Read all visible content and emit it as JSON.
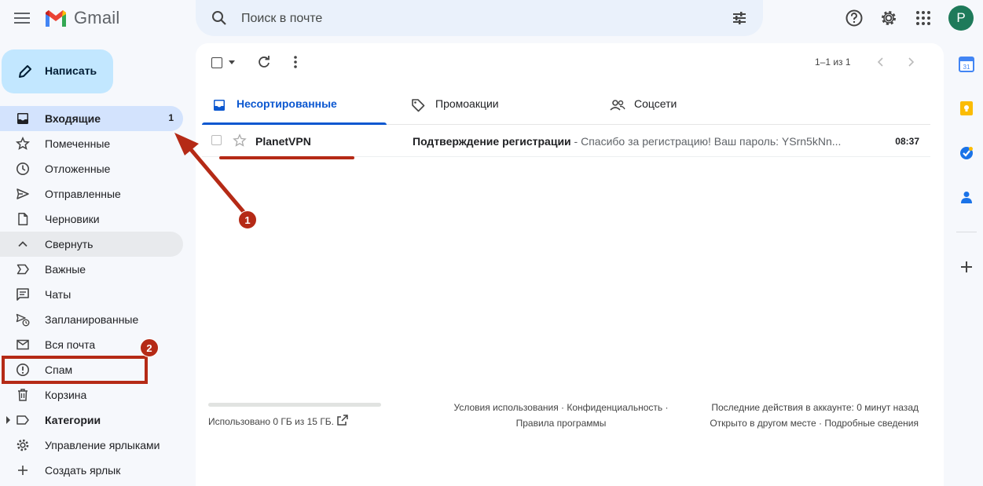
{
  "header": {
    "app_name": "Gmail",
    "search_placeholder": "Поиск в почте",
    "avatar_letter": "P"
  },
  "compose_label": "Написать",
  "sidebar": {
    "items": [
      {
        "label": "Входящие",
        "count": "1",
        "icon": "inbox-icon"
      },
      {
        "label": "Помеченные",
        "icon": "star-icon"
      },
      {
        "label": "Отложенные",
        "icon": "clock-icon"
      },
      {
        "label": "Отправленные",
        "icon": "send-icon"
      },
      {
        "label": "Черновики",
        "icon": "draft-icon"
      },
      {
        "label": "Свернуть",
        "icon": "chevron-up-icon"
      },
      {
        "label": "Важные",
        "icon": "important-icon"
      },
      {
        "label": "Чаты",
        "icon": "chat-icon"
      },
      {
        "label": "Запланированные",
        "icon": "scheduled-icon"
      },
      {
        "label": "Вся почта",
        "icon": "all-mail-icon"
      },
      {
        "label": "Спам",
        "icon": "spam-icon"
      },
      {
        "label": "Корзина",
        "icon": "trash-icon"
      },
      {
        "label": "Категории",
        "icon": "label-icon"
      },
      {
        "label": "Управление ярлыками",
        "icon": "gear-icon"
      },
      {
        "label": "Создать ярлык",
        "icon": "plus-icon"
      }
    ]
  },
  "toolbar": {
    "pager": "1–1 из 1"
  },
  "tabs": [
    {
      "label": "Несортированные",
      "icon": "inbox-icon"
    },
    {
      "label": "Промоакции",
      "icon": "tag-icon"
    },
    {
      "label": "Соцсети",
      "icon": "people-icon"
    }
  ],
  "emails": [
    {
      "sender": "PlanetVPN",
      "subject": "Подтверждение регистрации",
      "snippet": " - Спасибо за регистрацию! Ваш пароль: YSrn5kNn...",
      "time": "08:37"
    }
  ],
  "footer": {
    "storage": "Использовано 0 ГБ из 15 ГБ.",
    "storage_used_fraction": 0,
    "terms": "Условия использования",
    "privacy": "Конфиденциальность",
    "program_policies": "Правила программы",
    "last_activity": "Последние действия в аккаунте: 0 минут назад",
    "open_elsewhere": "Открыто в другом месте",
    "details": "Подробные сведения"
  },
  "annotations": {
    "badge_1": "1",
    "badge_2": "2",
    "color": "#b52a16"
  }
}
